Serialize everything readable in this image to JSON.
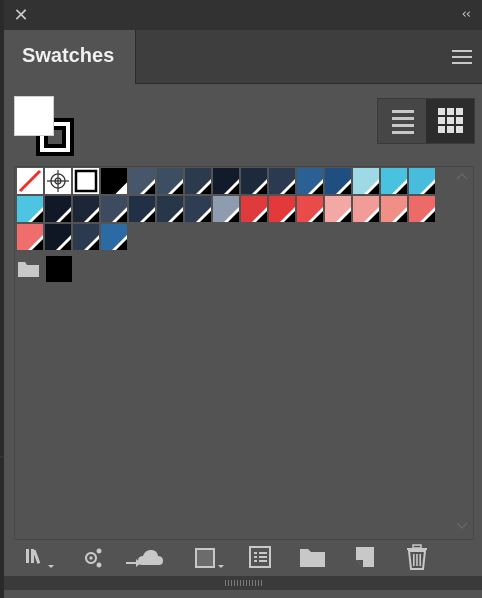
{
  "panel": {
    "tab_title": "Swatches",
    "close_glyph": "✕",
    "collapse_glyph": "‹‹"
  },
  "swatch_rows": [
    [
      {
        "kind": "none",
        "color": "#ffffff"
      },
      {
        "kind": "registration",
        "color": "#ffffff"
      },
      {
        "kind": "white",
        "color": "#ffffff"
      },
      {
        "kind": "black",
        "color": "#000000"
      },
      {
        "kind": "process",
        "color": "#47566a"
      },
      {
        "kind": "process",
        "color": "#3d4e63"
      },
      {
        "kind": "process",
        "color": "#2c3a4e"
      },
      {
        "kind": "process",
        "color": "#121b29"
      },
      {
        "kind": "process",
        "color": "#1d2a3c"
      },
      {
        "kind": "process",
        "color": "#2b3a50"
      },
      {
        "kind": "process",
        "color": "#2a6094"
      },
      {
        "kind": "process",
        "color": "#1e4f80"
      },
      {
        "kind": "process",
        "color": "#9ed9e6"
      },
      {
        "kind": "process",
        "color": "#49c2e0"
      },
      {
        "kind": "process",
        "color": "#47bcdc"
      }
    ],
    [
      {
        "kind": "process",
        "color": "#4cc4e2"
      },
      {
        "kind": "process",
        "color": "#111827"
      },
      {
        "kind": "process",
        "color": "#1d2636"
      },
      {
        "kind": "process",
        "color": "#3c4b60"
      },
      {
        "kind": "process",
        "color": "#223046"
      },
      {
        "kind": "process",
        "color": "#28364a"
      },
      {
        "kind": "process",
        "color": "#2e3d52"
      },
      {
        "kind": "process",
        "color": "#8d9caf"
      },
      {
        "kind": "process",
        "color": "#e03b3c"
      },
      {
        "kind": "process",
        "color": "#e4393a"
      },
      {
        "kind": "process",
        "color": "#e94a4a"
      },
      {
        "kind": "process",
        "color": "#f3a8a6"
      },
      {
        "kind": "process",
        "color": "#f29c98"
      },
      {
        "kind": "process",
        "color": "#ef8f86"
      },
      {
        "kind": "process",
        "color": "#ec6a68"
      }
    ],
    [
      {
        "kind": "process",
        "color": "#ee6d6d"
      },
      {
        "kind": "process",
        "color": "#0f1724"
      },
      {
        "kind": "process",
        "color": "#2c3a4f"
      },
      {
        "kind": "process",
        "color": "#2c6aa4"
      }
    ]
  ],
  "group": {
    "icon": "folder-icon",
    "swatches": [
      {
        "kind": "solid",
        "color": "#000000"
      }
    ]
  },
  "bottom_icons": [
    "library-icon",
    "color-theme-icon",
    "cloud-sync-icon",
    "swatch-kind-icon",
    "swatch-options-icon",
    "new-group-icon",
    "new-swatch-icon",
    "trash-icon"
  ]
}
